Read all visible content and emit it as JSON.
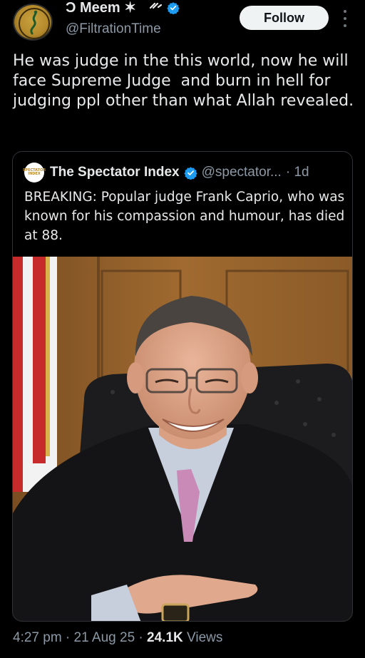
{
  "author": {
    "display_name": "Ɔ Meem ✶",
    "handle": "@FiltrationTime",
    "verified": true
  },
  "follow_label": "Follow",
  "tweet_text": "He was judge in the this world, now he will face Supreme Judge  and burn in hell for judging ppl other than what Allah revealed.",
  "quote": {
    "avatar_text": "SPECTATOR INDEX",
    "name": "The Spectator Index",
    "handle": "@spectator...",
    "time": "· 1d",
    "text": "BREAKING: Popular judge Frank Caprio, who was known for his compassion and humour, has died at 88."
  },
  "meta": {
    "time": "4:27 pm",
    "sep1": " · ",
    "date": "21 Aug 25",
    "sep2": " · ",
    "views_count": "24.1K",
    "views_label": " Views"
  },
  "colors": {
    "background": "#000000",
    "text": "#e7e9ea",
    "secondary": "#8b98a5",
    "verified": "#1d9bf0",
    "border": "#2f3336"
  }
}
